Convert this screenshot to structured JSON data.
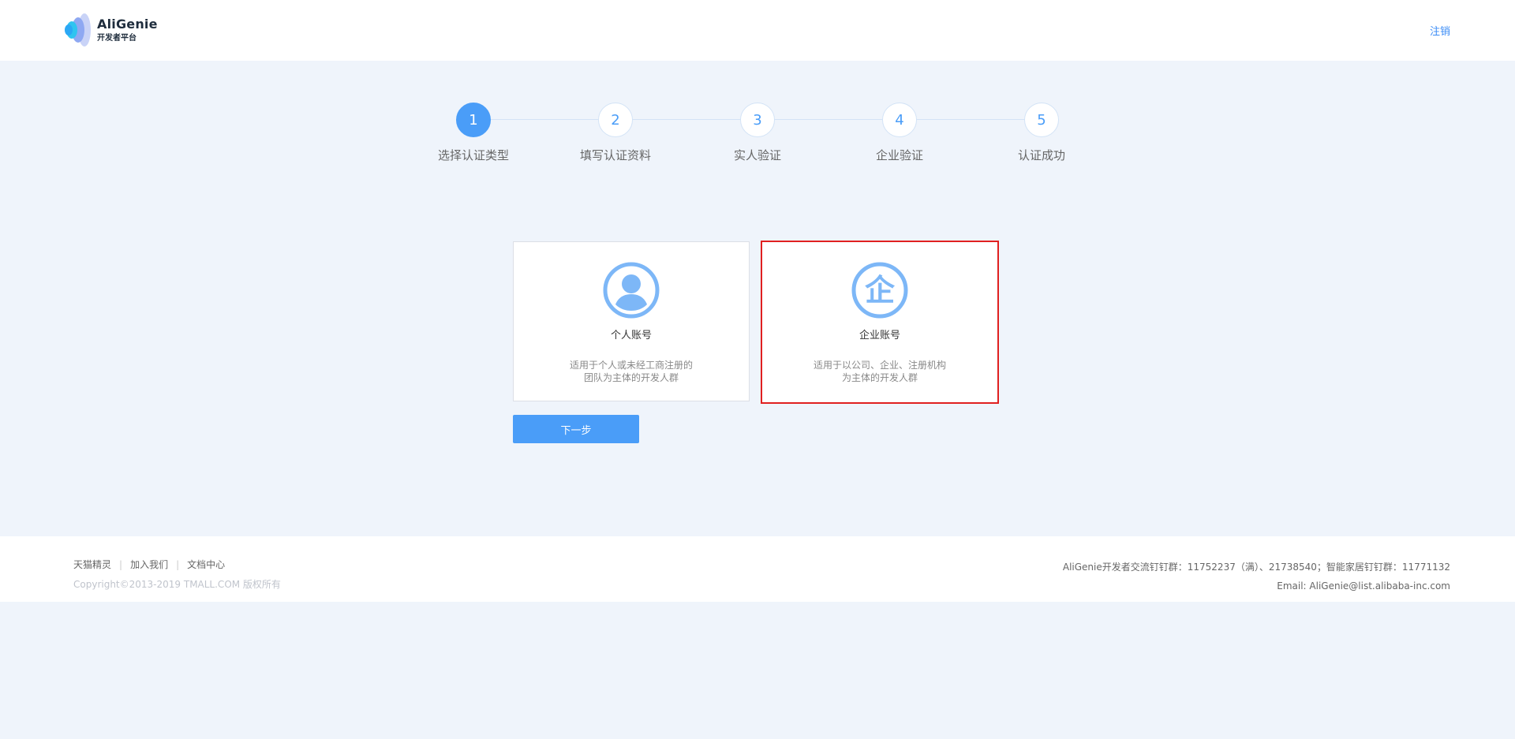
{
  "header": {
    "brand": "AliGenie",
    "subtitle": "开发者平台",
    "logout_label": "注销"
  },
  "steps": [
    {
      "number": "1",
      "label": "选择认证类型",
      "active": true
    },
    {
      "number": "2",
      "label": "填写认证资料",
      "active": false
    },
    {
      "number": "3",
      "label": "实人验证",
      "active": false
    },
    {
      "number": "4",
      "label": "企业验证",
      "active": false
    },
    {
      "number": "5",
      "label": "认证成功",
      "active": false
    }
  ],
  "cards": {
    "personal": {
      "title": "个人账号",
      "desc_line1": "适用于个人或未经工商注册的",
      "desc_line2": "团队为主体的开发人群",
      "icon": "user-circle-icon"
    },
    "enterprise": {
      "title": "企业账号",
      "desc_line1": "适用于以公司、企业、注册机构",
      "desc_line2": "为主体的开发人群",
      "icon": "enterprise-icon",
      "icon_glyph": "企",
      "selected": true
    }
  },
  "next_button": "下一步",
  "footer": {
    "links": [
      "天猫精灵",
      "加入我们",
      "文档中心"
    ],
    "copyright": "Copyright©2013-2019 TMALL.COM 版权所有",
    "contact_line": "AliGenie开发者交流钉钉群：11752237（满）、21738540；智能家居钉钉群：11771132",
    "email_line": "Email: AliGenie@list.alibaba-inc.com"
  },
  "colors": {
    "accent": "#4a9df8",
    "icon": "#7db7f7",
    "selected_border": "#e02020",
    "background": "#eff4fb"
  }
}
